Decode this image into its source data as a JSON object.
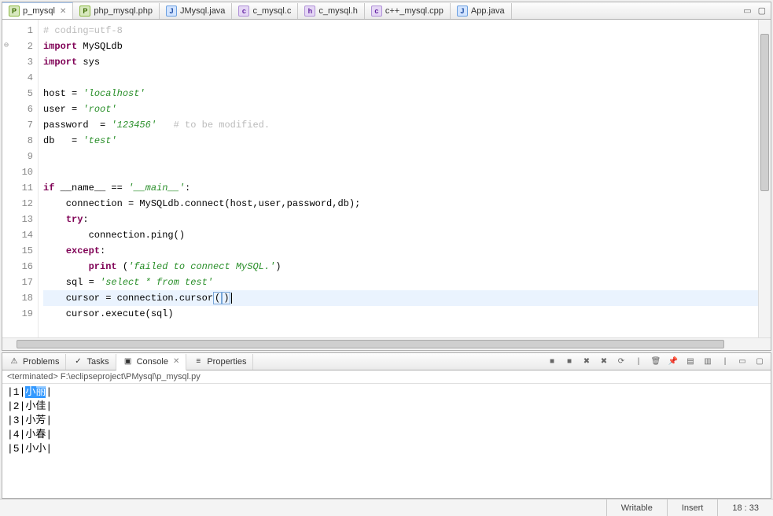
{
  "tabs": [
    {
      "label": "p_mysql",
      "iconClass": "icon-p",
      "iconLetter": "P",
      "active": true,
      "closable": true
    },
    {
      "label": "php_mysql.php",
      "iconClass": "icon-p",
      "iconLetter": "P",
      "active": false,
      "closable": false
    },
    {
      "label": "JMysql.java",
      "iconClass": "icon-j",
      "iconLetter": "J",
      "active": false,
      "closable": false
    },
    {
      "label": "c_mysql.c",
      "iconClass": "icon-c",
      "iconLetter": "c",
      "active": false,
      "closable": false
    },
    {
      "label": "c_mysql.h",
      "iconClass": "icon-h",
      "iconLetter": "h",
      "active": false,
      "closable": false
    },
    {
      "label": "c++_mysql.cpp",
      "iconClass": "icon-c",
      "iconLetter": "c",
      "active": false,
      "closable": false
    },
    {
      "label": "App.java",
      "iconClass": "icon-j",
      "iconLetter": "J",
      "active": false,
      "closable": false
    }
  ],
  "code": {
    "lines": [
      {
        "n": 1,
        "segs": [
          {
            "t": "# coding=utf-8",
            "cls": "cmt"
          }
        ]
      },
      {
        "n": 2,
        "fold": true,
        "segs": [
          {
            "t": "import",
            "cls": "kw"
          },
          {
            "t": " MySQLdb"
          }
        ]
      },
      {
        "n": 3,
        "segs": [
          {
            "t": "import",
            "cls": "kw"
          },
          {
            "t": " sys"
          }
        ]
      },
      {
        "n": 4,
        "segs": []
      },
      {
        "n": 5,
        "segs": [
          {
            "t": "host = "
          },
          {
            "t": "'localhost'",
            "cls": "str"
          }
        ]
      },
      {
        "n": 6,
        "segs": [
          {
            "t": "user = "
          },
          {
            "t": "'root'",
            "cls": "str"
          }
        ]
      },
      {
        "n": 7,
        "segs": [
          {
            "t": "password  = "
          },
          {
            "t": "'123456'",
            "cls": "str"
          },
          {
            "t": "   "
          },
          {
            "t": "# to be modified.",
            "cls": "cmt"
          }
        ]
      },
      {
        "n": 8,
        "segs": [
          {
            "t": "db   = "
          },
          {
            "t": "'test'",
            "cls": "str"
          }
        ]
      },
      {
        "n": 9,
        "segs": []
      },
      {
        "n": 10,
        "segs": []
      },
      {
        "n": 11,
        "segs": [
          {
            "t": "if",
            "cls": "kw"
          },
          {
            "t": " __name__ == "
          },
          {
            "t": "'__main__'",
            "cls": "str"
          },
          {
            "t": ":"
          }
        ]
      },
      {
        "n": 12,
        "segs": [
          {
            "t": "    connection = MySQLdb.connect(host,user,password,db);"
          }
        ]
      },
      {
        "n": 13,
        "segs": [
          {
            "t": "    "
          },
          {
            "t": "try",
            "cls": "kw"
          },
          {
            "t": ":"
          }
        ]
      },
      {
        "n": 14,
        "segs": [
          {
            "t": "        connection.ping()"
          }
        ]
      },
      {
        "n": 15,
        "segs": [
          {
            "t": "    "
          },
          {
            "t": "except",
            "cls": "kw"
          },
          {
            "t": ":"
          }
        ]
      },
      {
        "n": 16,
        "segs": [
          {
            "t": "        "
          },
          {
            "t": "print",
            "cls": "kw"
          },
          {
            "t": " ("
          },
          {
            "t": "'failed to connect MySQL.'",
            "cls": "str"
          },
          {
            "t": ")"
          }
        ]
      },
      {
        "n": 17,
        "segs": [
          {
            "t": "    sql = "
          },
          {
            "t": "'select * from test'",
            "cls": "str"
          }
        ]
      },
      {
        "n": 18,
        "hl": true,
        "segs": [
          {
            "t": "    cursor = connection.cursor"
          },
          {
            "t": "(",
            "cls": "bracket-box"
          },
          {
            "t": ")",
            "cls": "bracket-box"
          }
        ],
        "caret": true
      },
      {
        "n": 19,
        "segs": [
          {
            "t": "    cursor.execute(sql)"
          }
        ]
      }
    ]
  },
  "views": {
    "tabs": [
      {
        "label": "Problems",
        "icon": "⚠",
        "active": false
      },
      {
        "label": "Tasks",
        "icon": "✓",
        "active": false
      },
      {
        "label": "Console",
        "icon": "▣",
        "active": true,
        "closable": true
      },
      {
        "label": "Properties",
        "icon": "≡",
        "active": false
      }
    ],
    "toolbar_icons": [
      "terminate-icon",
      "terminate-all-icon",
      "remove-icon",
      "remove-all-icon",
      "scroll-lock-icon",
      "separator",
      "clear-console-icon",
      "pin-console-icon",
      "display-icon",
      "open-console-icon",
      "separator",
      "minimize-icon",
      "maximize-icon"
    ]
  },
  "terminated_header": "<terminated> F:\\eclipseproject\\PMysql\\p_mysql.py",
  "console_output": [
    {
      "pre": "|1|",
      "name": "小丽",
      "post": "|",
      "selected": true
    },
    {
      "pre": "|2|",
      "name": "小佳",
      "post": "|",
      "selected": false
    },
    {
      "pre": "|3|",
      "name": "小芳",
      "post": "|",
      "selected": false
    },
    {
      "pre": "|4|",
      "name": "小春",
      "post": "|",
      "selected": false
    },
    {
      "pre": "|5|",
      "name": "小小",
      "post": "|",
      "selected": false
    }
  ],
  "status": {
    "writable": "Writable",
    "insert": "Insert",
    "pos": "18 : 33"
  }
}
